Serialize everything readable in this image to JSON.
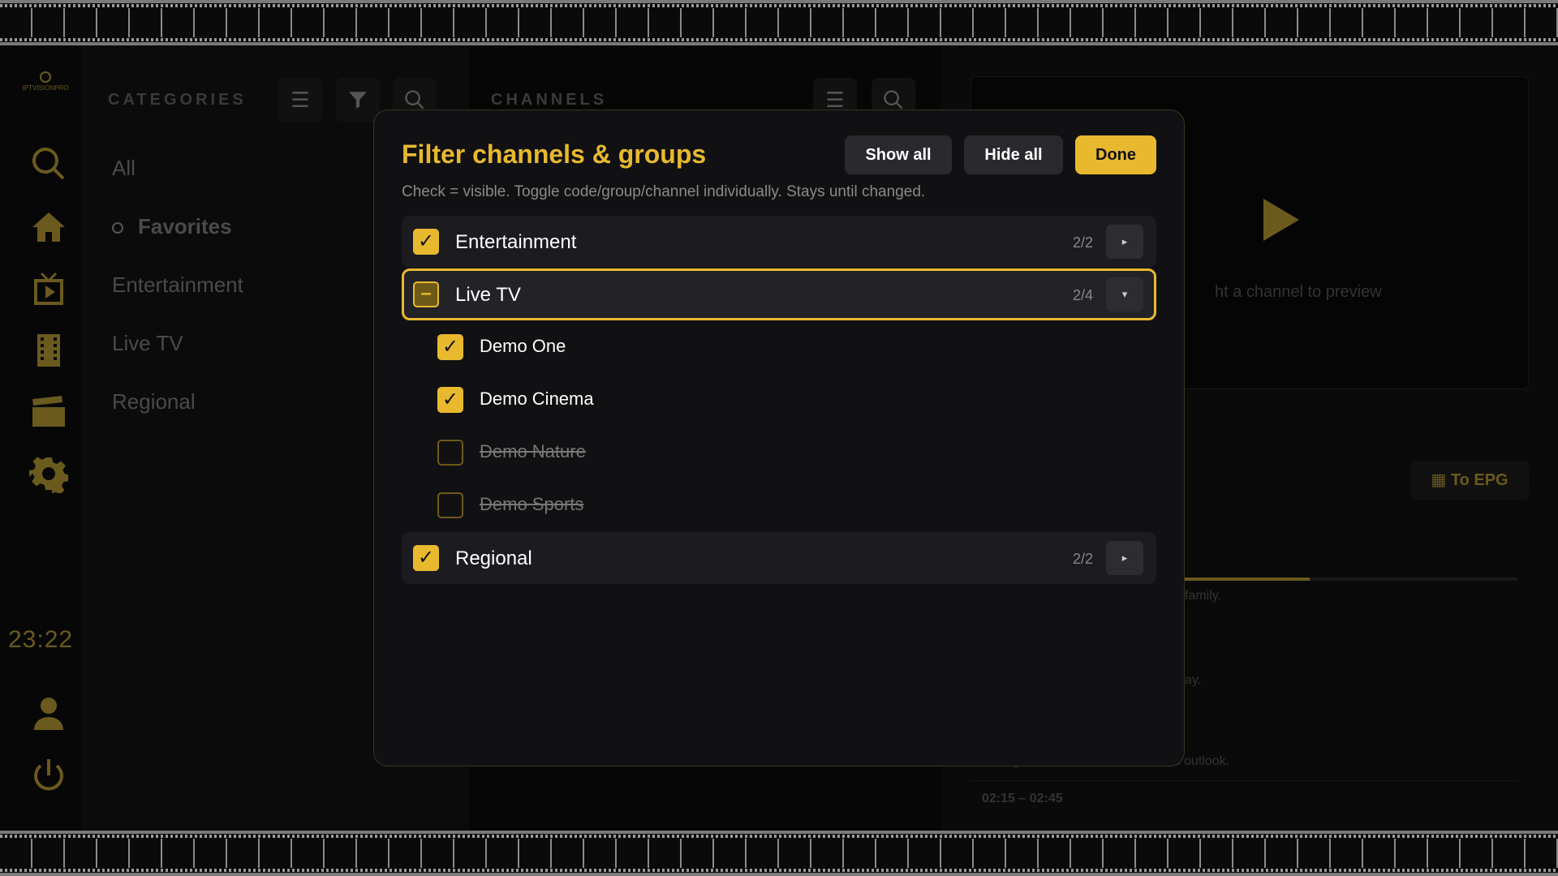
{
  "background": {
    "logo_text": "IPTVISIONPRO",
    "clock": "23:22",
    "categories": {
      "header": "CATEGORIES",
      "items": [
        "All",
        "Favorites",
        "Entertainment",
        "Live TV",
        "Regional"
      ]
    },
    "channels": {
      "header": "CHANNELS"
    },
    "preview": {
      "hint": "ht a channel to preview",
      "to_epg": "▦ To EPG",
      "progress": 0.62,
      "epg_lines": [
        "family.",
        "ay.",
        "he day in review, with weather and outlook.",
        "02:15 – 02:45"
      ]
    }
  },
  "modal": {
    "title": "Filter channels & groups",
    "subtitle": "Check = visible. Toggle code/group/channel individually. Stays until changed.",
    "buttons": {
      "show_all": "Show all",
      "hide_all": "Hide all",
      "done": "Done"
    },
    "groups": [
      {
        "label": "Entertainment",
        "count": "2/2",
        "state": "checked",
        "expander": "▸"
      },
      {
        "label": "Live TV",
        "count": "2/4",
        "state": "partial",
        "expander": "▾",
        "channels": [
          {
            "label": "Demo One",
            "state": "checked"
          },
          {
            "label": "Demo Cinema",
            "state": "checked"
          },
          {
            "label": "Demo Nature",
            "state": "unchecked"
          },
          {
            "label": "Demo Sports",
            "state": "unchecked"
          }
        ]
      },
      {
        "label": "Regional",
        "count": "2/2",
        "state": "checked",
        "expander": "▸"
      }
    ],
    "marks": {
      "checked": "✓",
      "partial": "–"
    }
  },
  "colors": {
    "accent": "#e8b92f",
    "panel": "#111113"
  }
}
